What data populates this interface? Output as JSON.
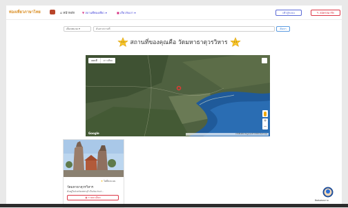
{
  "navbar": {
    "brand": "ท่องเที่ยวภาษาไทย",
    "home": "หน้าหลัก",
    "dropdowns": [
      "สถานที่ท่องเที่ยว",
      "เกี่ยวกับเรา"
    ],
    "login_label": "เข้าสู่ระบบ",
    "register_label": "สมัครสมาชิก"
  },
  "search": {
    "category_value": "เลือกหมวด",
    "placeholder": "ค้นหาสถานที่",
    "button_label": "ค้นหา"
  },
  "heading": {
    "text": "สถานที่ของคุณคือ วัดมหาธาตุวรวิหาร"
  },
  "map": {
    "map_tab": "แผนที่",
    "satellite_tab": "ดาวเทียม",
    "google_label": "Google",
    "attribution": "แป้นพิมพ์ลัด  ข้อมูลแผนที่ ©2024  ข้อกำหนด"
  },
  "card": {
    "rating": "ไม่มีคะแนน",
    "title": "วัดมหาธาตุวรวิหาร",
    "description": "ตั้งอยู่ในจังหวัดเพชรบุรี เป็นวัดเก่าแก่...",
    "button_label": "รายละเอียด"
  },
  "chat": {
    "label": "ติดต่อสอบถาม"
  },
  "colors": {
    "brand": "#d88a1c",
    "primary": "#3f4fcf",
    "danger": "#dc3545",
    "star": "#f7c52b"
  }
}
